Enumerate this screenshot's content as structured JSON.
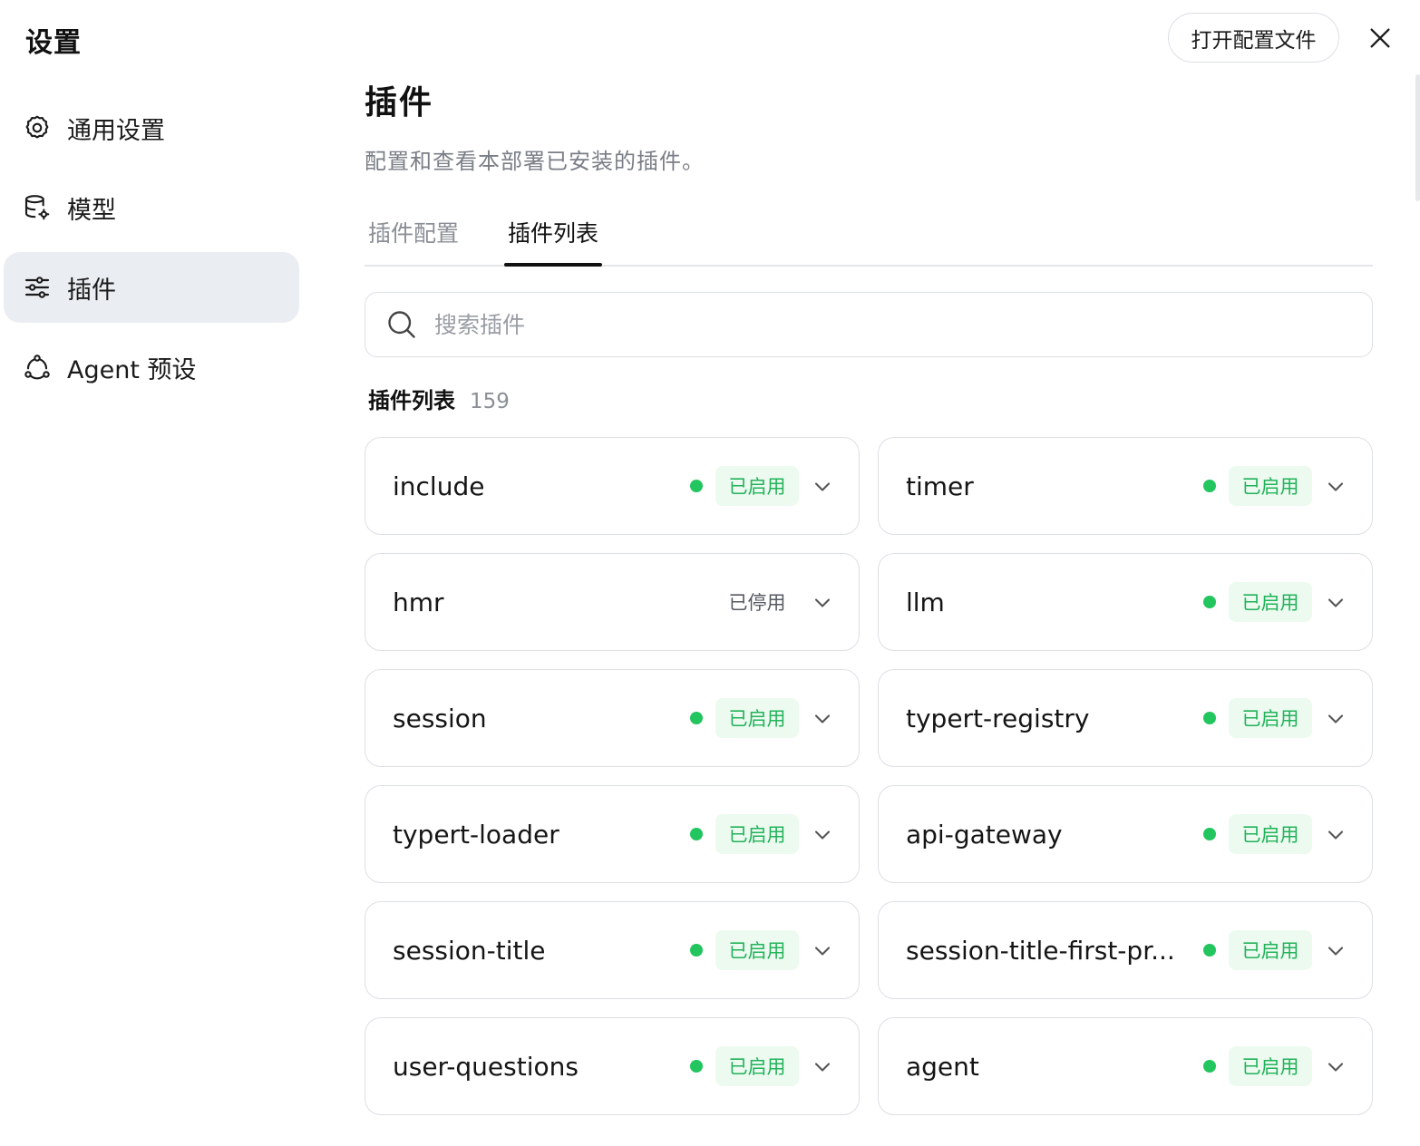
{
  "sidebar": {
    "title": "设置",
    "items": [
      {
        "label": "通用设置",
        "icon": "gear-icon",
        "active": false
      },
      {
        "label": "模型",
        "icon": "database-gear-icon",
        "active": false
      },
      {
        "label": "插件",
        "icon": "sliders-icon",
        "active": true
      },
      {
        "label": "Agent 预设",
        "icon": "agent-network-icon",
        "active": false
      }
    ]
  },
  "header": {
    "open_config_label": "打开配置文件",
    "close_icon": "close-icon"
  },
  "main": {
    "title": "插件",
    "description": "配置和查看本部署已安装的插件。",
    "tabs": [
      {
        "label": "插件配置",
        "active": false
      },
      {
        "label": "插件列表",
        "active": true
      }
    ],
    "search": {
      "placeholder": "搜索插件",
      "value": ""
    },
    "list": {
      "title": "插件列表",
      "count": "159",
      "plugins": [
        {
          "name": "include",
          "status": "已启用",
          "enabled": true
        },
        {
          "name": "timer",
          "status": "已启用",
          "enabled": true
        },
        {
          "name": "hmr",
          "status": "已停用",
          "enabled": false
        },
        {
          "name": "llm",
          "status": "已启用",
          "enabled": true
        },
        {
          "name": "session",
          "status": "已启用",
          "enabled": true
        },
        {
          "name": "typert-registry",
          "status": "已启用",
          "enabled": true
        },
        {
          "name": "typert-loader",
          "status": "已启用",
          "enabled": true
        },
        {
          "name": "api-gateway",
          "status": "已启用",
          "enabled": true
        },
        {
          "name": "session-title",
          "status": "已启用",
          "enabled": true
        },
        {
          "name": "session-title-first-pr...",
          "status": "已启用",
          "enabled": true
        },
        {
          "name": "user-questions",
          "status": "已启用",
          "enabled": true
        },
        {
          "name": "agent",
          "status": "已启用",
          "enabled": true
        }
      ]
    }
  },
  "colors": {
    "enabled_green": "#22c55e",
    "enabled_badge_bg": "#ecfaf0",
    "active_nav_bg": "#eaedf2"
  }
}
